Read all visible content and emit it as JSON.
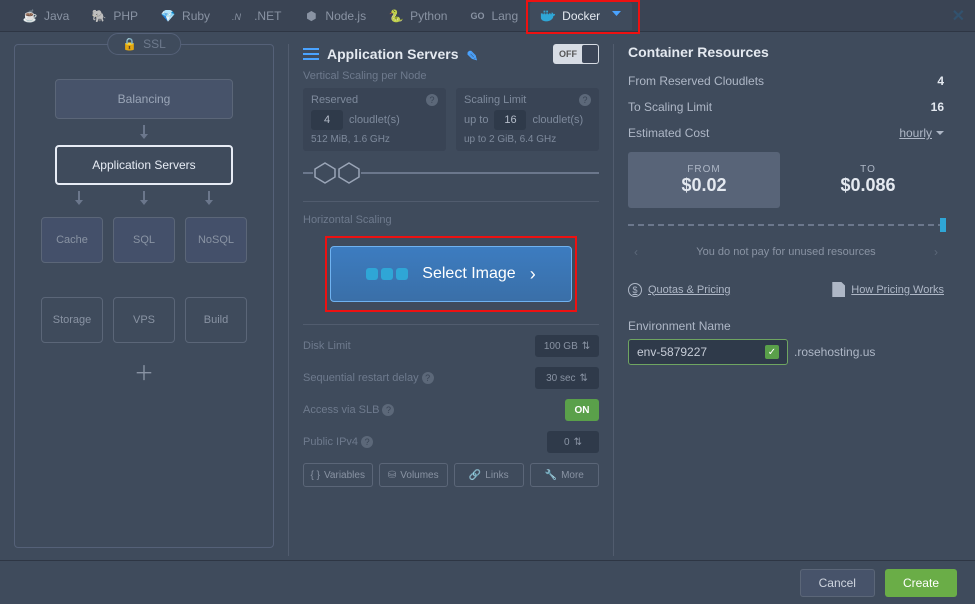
{
  "tabs": {
    "java": "Java",
    "php": "PHP",
    "ruby": "Ruby",
    "dotnet": ".NET",
    "nodejs": "Node.js",
    "python": "Python",
    "golang": "Lang",
    "docker": "Docker"
  },
  "topology": {
    "ssl": "SSL",
    "balancing": "Balancing",
    "app_servers": "Application Servers",
    "cache": "Cache",
    "sql": "SQL",
    "nosql": "NoSQL",
    "storage": "Storage",
    "vps": "VPS",
    "build": "Build"
  },
  "mid": {
    "title": "Application Servers",
    "off": "OFF",
    "vscale": "Vertical Scaling per Node",
    "reserved": {
      "label": "Reserved",
      "count": "4",
      "unit": "cloudlet(s)",
      "spec": "512 MiB, 1.6 GHz"
    },
    "limit": {
      "label": "Scaling Limit",
      "prefix": "up to",
      "count": "16",
      "unit": "cloudlet(s)",
      "spec": "up to 2 GiB, 6.4 GHz"
    },
    "hscale": "Horizontal Scaling",
    "select_image": "Select Image",
    "disk_limit_label": "Disk Limit",
    "disk_limit_value": "100 GB",
    "seq_restart_label": "Sequential restart delay",
    "seq_restart_value": "30 sec",
    "access_slb_label": "Access via SLB",
    "access_slb_value": "ON",
    "public_ipv4_label": "Public IPv4",
    "public_ipv4_value": "0",
    "variables": "Variables",
    "volumes": "Volumes",
    "links": "Links",
    "more": "More"
  },
  "right": {
    "title": "Container Resources",
    "from_reserved": "From Reserved Cloudlets",
    "from_reserved_v": "4",
    "to_limit": "To Scaling Limit",
    "to_limit_v": "16",
    "estimated": "Estimated Cost",
    "period": "hourly",
    "from_label": "FROM",
    "from_amt": "$0.02",
    "to_label": "TO",
    "to_amt": "$0.086",
    "info": "You do not pay for unused resources",
    "quotas": "Quotas & Pricing",
    "how_pricing": "How Pricing Works",
    "env_label": "Environment Name",
    "env_value": "env-5879227",
    "domain": ".rosehosting.us"
  },
  "footer": {
    "cancel": "Cancel",
    "create": "Create"
  }
}
